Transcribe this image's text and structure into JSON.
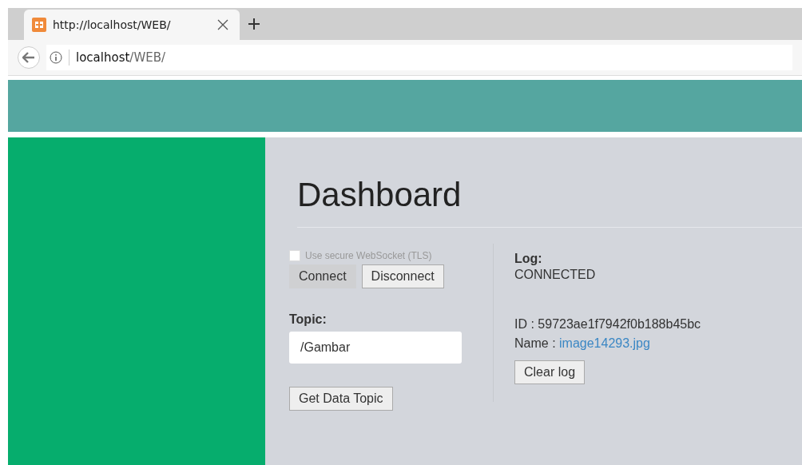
{
  "browser": {
    "tab_title": "http://localhost/WEB/",
    "address_host": "localhost",
    "address_path": "/WEB/"
  },
  "page": {
    "title": "Dashboard",
    "secure_option": {
      "label": "Use secure WebSocket (TLS)",
      "checked": false,
      "disabled": true
    },
    "connection_buttons": [
      {
        "label": "Connect",
        "disabled": true
      },
      {
        "label": "Disconnect",
        "disabled": false
      }
    ],
    "topic_label": "Topic:",
    "topic_value": "/Gambar",
    "topic_button": "Get Data Topic",
    "log": {
      "label": "Log:",
      "status": "CONNECTED",
      "id_label": "ID :",
      "id_value": "59723ae1f7942f0b188b45bc",
      "name_label": "Name :",
      "name_value": "image14293.jpg",
      "clear_button": "Clear log"
    }
  }
}
